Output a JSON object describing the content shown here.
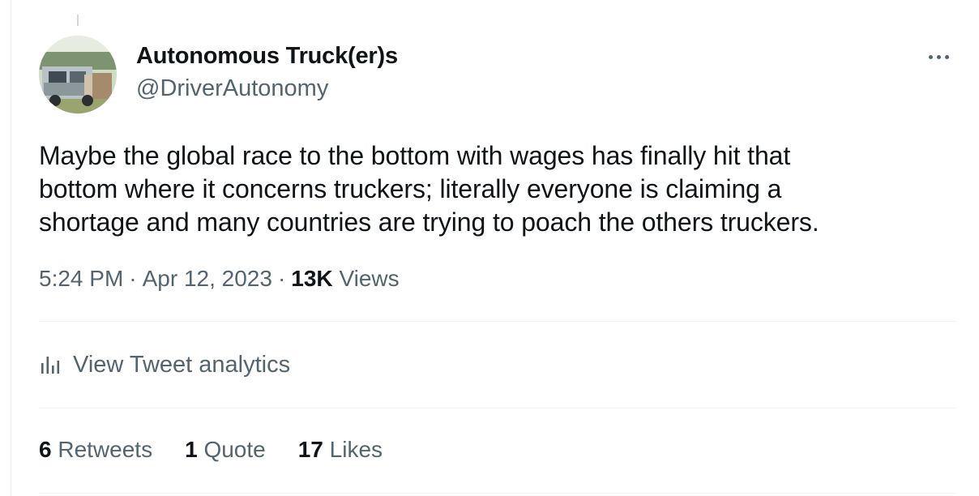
{
  "tweet": {
    "author": {
      "display_name": "Autonomous Truck(er)s",
      "handle": "@DriverAutonomy"
    },
    "text_lines": [
      "Maybe the global race to the bottom with wages has finally hit that",
      "bottom where it concerns truckers; literally everyone is claiming a",
      "shortage and many countries are trying to poach the others truckers."
    ],
    "time": "5:24 PM",
    "date": "Apr 12, 2023",
    "separator": "·",
    "views": {
      "count": "13K",
      "label": "Views"
    },
    "analytics_label": "View Tweet analytics",
    "stats": {
      "retweets": {
        "count": "6",
        "label": "Retweets"
      },
      "quotes": {
        "count": "1",
        "label": "Quote"
      },
      "likes": {
        "count": "17",
        "label": "Likes"
      }
    }
  },
  "icons": {
    "more": "more-horizontal-icon",
    "analytics": "bar-chart-icon"
  },
  "colors": {
    "text_primary": "#0f1419",
    "text_secondary": "#536471",
    "divider": "#eff3f4"
  }
}
